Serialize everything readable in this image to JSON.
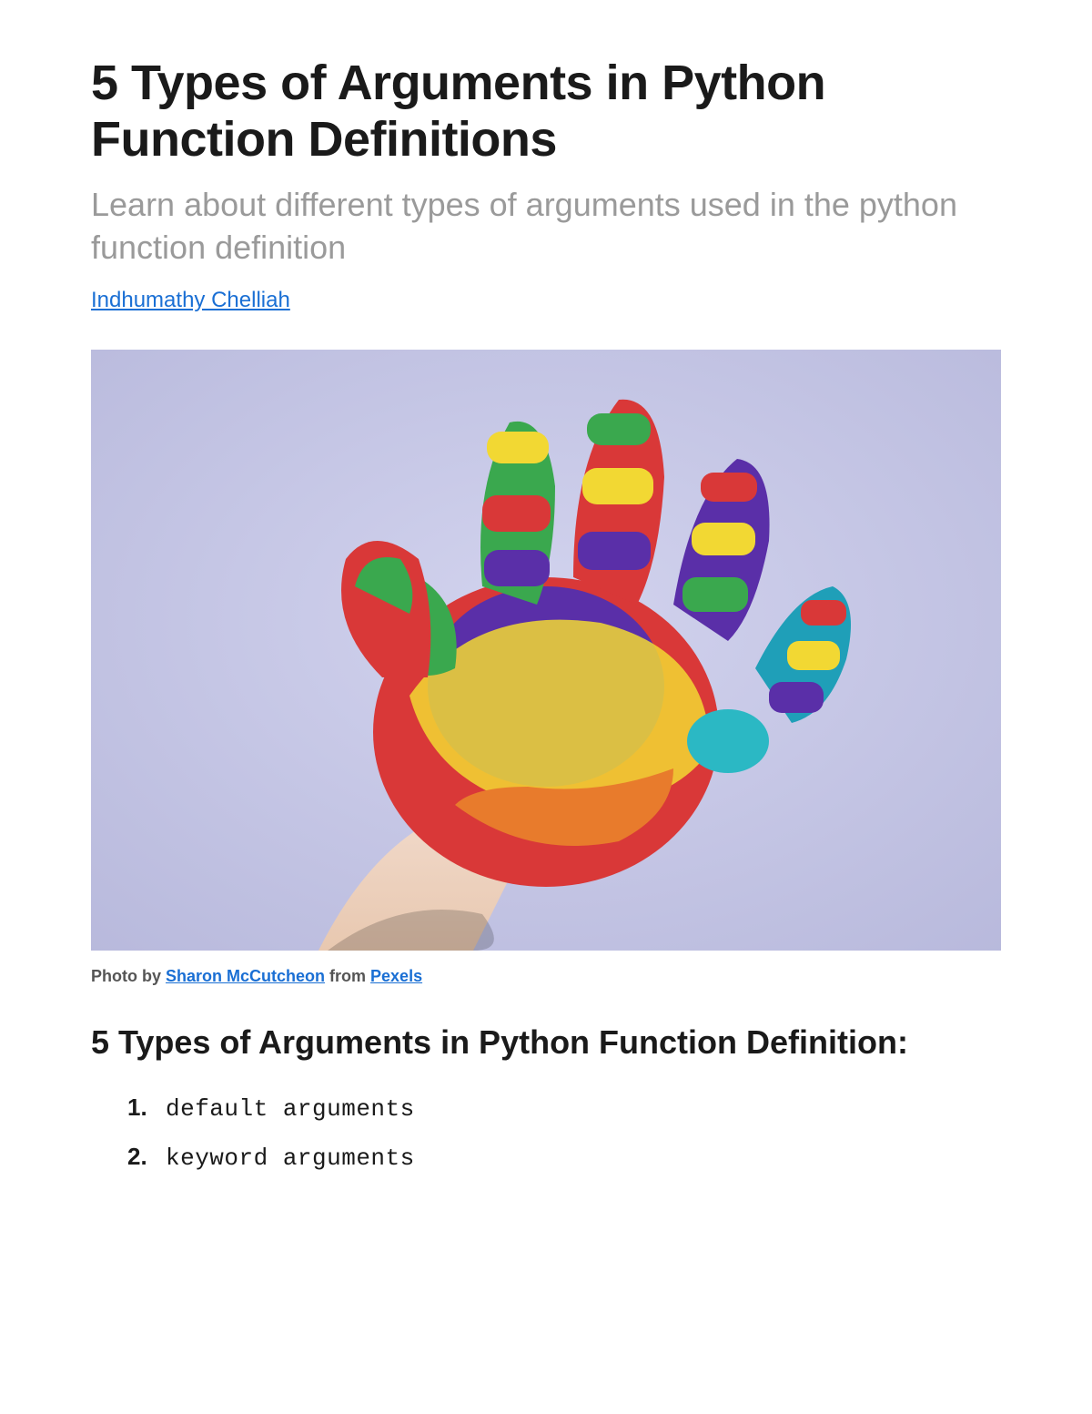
{
  "article": {
    "title": "5 Types of Arguments in Python Function Definitions",
    "subtitle": "Learn about different types of arguments used in the python function definition",
    "author": "Indhumathy Chelliah"
  },
  "image_caption": {
    "prefix": "Photo by ",
    "photographer": "Sharon McCutcheon",
    "middle": " from ",
    "source": "Pexels"
  },
  "section": {
    "heading": "5 Types of Arguments in Python Function Definition:"
  },
  "arguments": {
    "item1_num": "1.",
    "item1_text": "default arguments",
    "item2_num": "2.",
    "item2_text": "keyword arguments"
  }
}
